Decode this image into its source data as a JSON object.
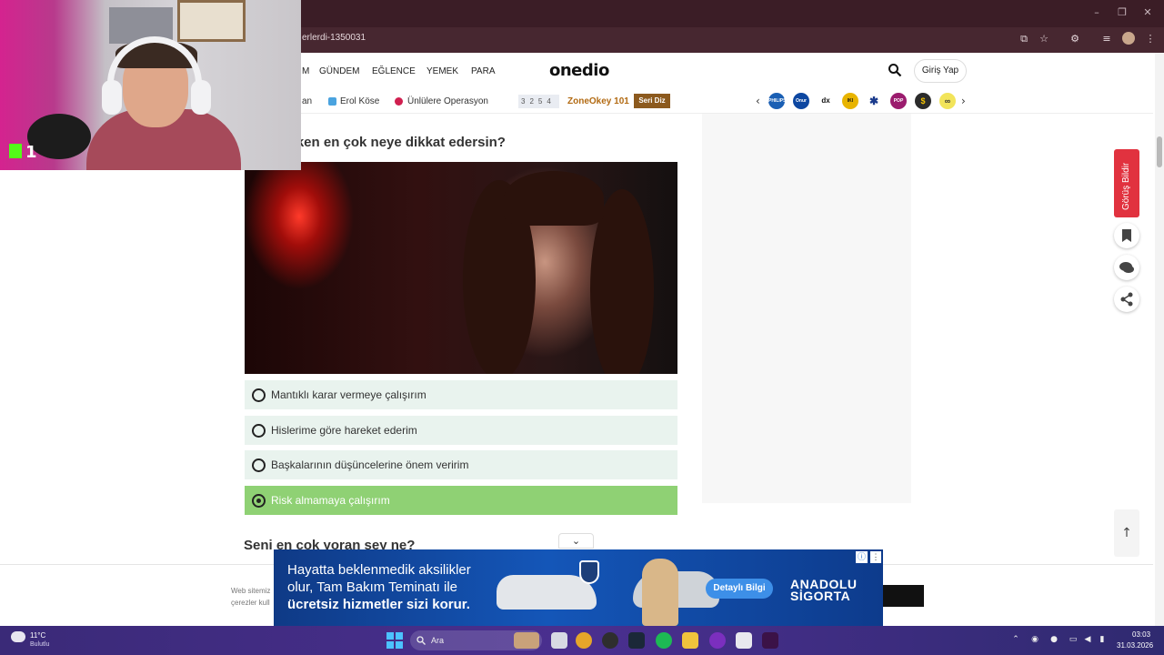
{
  "browser": {
    "url": "erlerdi-1350031",
    "window_controls": [
      "–",
      "❐",
      "✕"
    ]
  },
  "header": {
    "logo": "onedio",
    "nav": [
      "M",
      "GÜNDEM",
      "EĞLENCE",
      "YEMEK",
      "PARA"
    ],
    "login_label": "Giriş Yap"
  },
  "subnav": {
    "items": [
      "an",
      "Erol Köse",
      "Ünlülere Operasyon"
    ],
    "zone_numbers": "3254",
    "zone_label": "ZoneOkey 101",
    "seri_badge": "Seri Diz",
    "brands": [
      "PHILIPS",
      "Onur",
      "dx",
      "IKI",
      "✱",
      "POP",
      "$",
      "∞"
    ]
  },
  "quiz": {
    "question_partial": "rken en çok neye dikkat edersin?",
    "options": [
      {
        "label": "Mantıklı karar vermeye çalışırım",
        "selected": false
      },
      {
        "label": "Hislerime göre hareket ederim",
        "selected": false
      },
      {
        "label": "Başkalarının düşüncelerine önem veririm",
        "selected": false
      },
      {
        "label": "Risk almamaya çalışırım",
        "selected": true
      }
    ],
    "next_question_partial": "Seni en çok yoran şey ne?"
  },
  "sidebar": {
    "feedback_label": "Görüş Bildir"
  },
  "cookie": {
    "text_line1": "Web sitemiz",
    "text_line2": "çerezler kull",
    "accept_label": "Et"
  },
  "banner_ad": {
    "line1": "Hayatta beklenmedik aksilikler",
    "line2": "olur, Tam Bakım Teminatı ile",
    "line3": "ücretsiz hizmetler sizi korur.",
    "cta": "Detaylı Bilgi",
    "brand_line1": "ANADOLU",
    "brand_line2": "SİGORTA"
  },
  "webcam": {
    "badge": "1"
  },
  "taskbar": {
    "weather_temp": "11°C",
    "weather_desc": "Bulutlu",
    "search_label": "Ara",
    "time": "03:03",
    "date": "31.03.2026"
  },
  "colors": {
    "selected_option": "#8fd174",
    "option_bg": "#e9f3ee",
    "feedback": "#e1323f",
    "chrome": "#3b1d26"
  }
}
